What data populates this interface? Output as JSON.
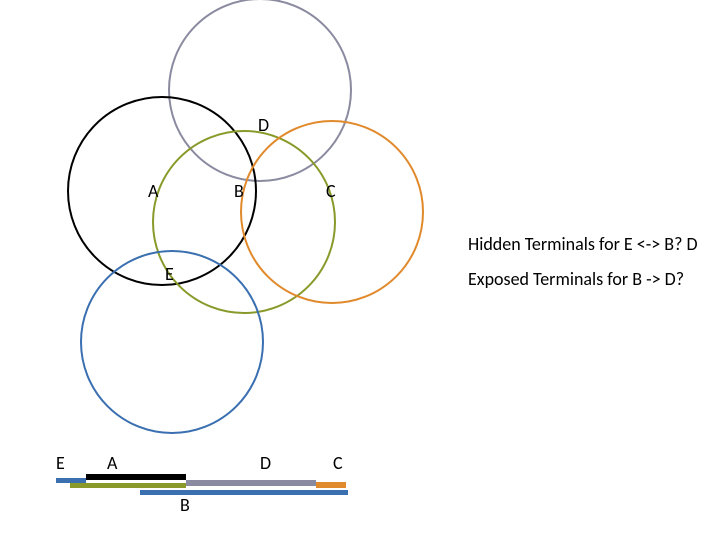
{
  "circles": {
    "A_label": "A",
    "B_label": "B",
    "C_label": "C",
    "D_label": "D",
    "E_label": "E"
  },
  "colors": {
    "black": "#000000",
    "olive": "#8a9a2a",
    "orange": "#e08a2c",
    "blue": "#3a6fb0",
    "purple_grey": "#8a8aa0"
  },
  "text": {
    "hidden": "Hidden Terminals for E <-> B?  D",
    "exposed": "Exposed Terminals for B -> D?"
  },
  "timeline": {
    "E": "E",
    "A": "A",
    "B": "B",
    "D": "D",
    "C": "C"
  }
}
